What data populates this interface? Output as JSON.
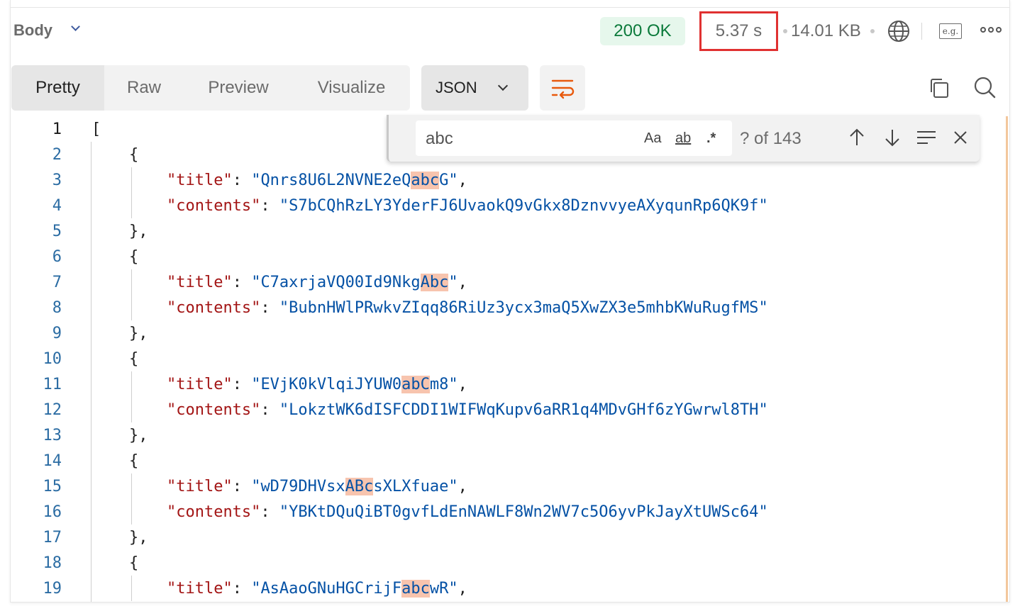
{
  "header": {
    "body_label": "Body",
    "status": "200 OK",
    "time": "5.37 s",
    "size": "14.01 KB",
    "globe_icon": "globe-icon",
    "example_icon_label": "e.g.",
    "more_icon": "more-icon",
    "status_color": "#0b7a3b",
    "highlight_box_color": "#e03131"
  },
  "view": {
    "tabs": [
      "Pretty",
      "Raw",
      "Preview",
      "Visualize"
    ],
    "active_tab": "Pretty",
    "format": "JSON",
    "wrap_icon": "wrap-lines-icon",
    "copy_icon": "copy-icon",
    "search_icon": "search-icon"
  },
  "find": {
    "value": "abc",
    "match_case_label": "Aa",
    "whole_word_label": "ab",
    "regex_label": ".*",
    "count": "? of 143"
  },
  "code": {
    "open_bracket": "[",
    "entries": [
      {
        "title_pre": "Qnrs8U6L2NVNE2eQ",
        "title_match": "abc",
        "title_post": "G",
        "contents": "S7bCQhRzLY3YderFJ6UvaokQ9vGkx8DznvvyeAXyqunRp6QK9f"
      },
      {
        "title_pre": "C7axrjaVQ00Id9Nkg",
        "title_match": "Abc",
        "title_post": "",
        "contents": "BubnHWlPRwkvZIqq86RiUz3ycx3maQ5XwZX3e5mhbKWuRugfMS"
      },
      {
        "title_pre": "EVjK0kVlqiJYUW0",
        "title_match": "abC",
        "title_post": "m8",
        "contents": "LokztWK6dISFCDDI1WIFWqKupv6aRR1q4MDvGHf6zYGwrwl8TH"
      },
      {
        "title_pre": "wD79DHVsx",
        "title_match": "ABc",
        "title_post": "sXLXfuae",
        "contents": "YBKtDQuQiBT0gvfLdEnNAWLF8Wn2WV7c5O6yvPkJayXtUWSc64"
      },
      {
        "title_pre": "AsAaoGNuHGCrijF",
        "title_match": "abc",
        "title_post": "wR",
        "contents": ""
      }
    ],
    "key_title": "\"title\"",
    "key_contents": "\"contents\"",
    "line_numbers": [
      "1",
      "2",
      "3",
      "4",
      "5",
      "6",
      "7",
      "8",
      "9",
      "10",
      "11",
      "12",
      "13",
      "14",
      "15",
      "16",
      "17",
      "18",
      "19"
    ],
    "key_color": "#a31515",
    "string_color": "#0451a5",
    "match_highlight_color": "#f7c4ae"
  }
}
